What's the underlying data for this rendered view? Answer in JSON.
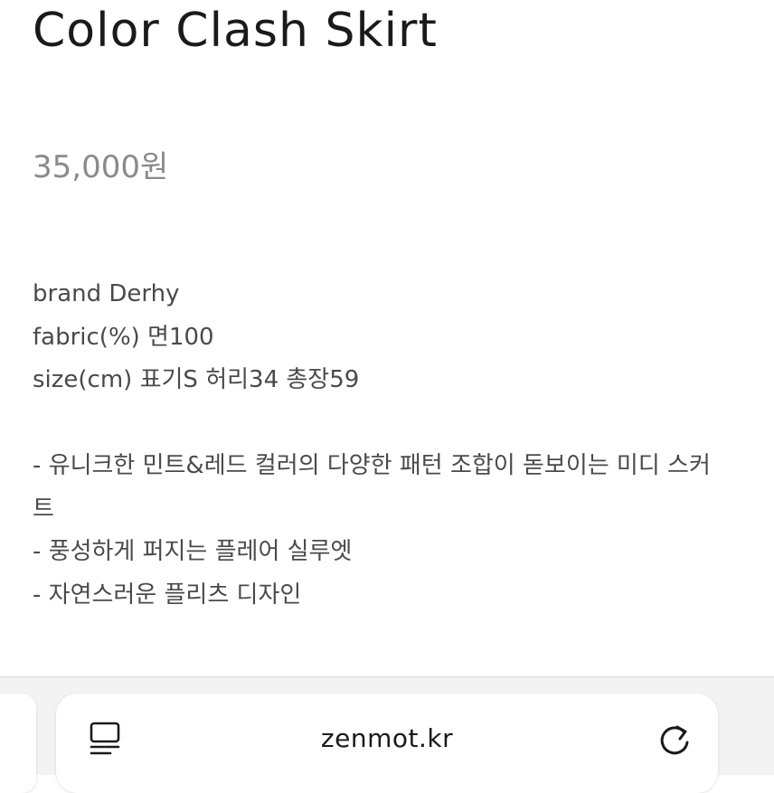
{
  "product": {
    "title": "Color Clash Skirt",
    "price": "35,000원",
    "details": [
      "brand Derhy",
      "fabric(%) 면100",
      "size(cm) 표기S 허리34 총장59"
    ],
    "features": [
      "- 유니크한 민트&레드 컬러의 다양한 패턴 조합이 돋보이는 미디 스커트",
      "- 풍성하게 퍼지는 플레어 실루엣",
      "- 자연스러운 플리츠 디자인"
    ]
  },
  "browser": {
    "url": "zenmot.kr",
    "reader_icon": "reader-mode-icon",
    "reload_icon": "reload-icon"
  }
}
